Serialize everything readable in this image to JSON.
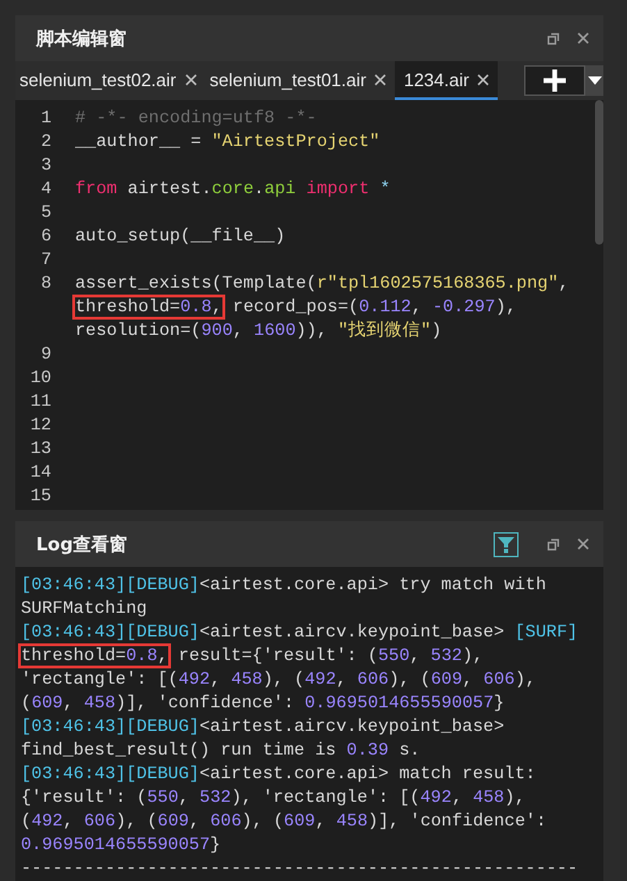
{
  "editor": {
    "title": "脚本编辑窗",
    "tabs": [
      {
        "label": "selenium_test02.air",
        "selected": false
      },
      {
        "label": "selenium_test01.air",
        "selected": false
      },
      {
        "label": "1234.air",
        "selected": true
      }
    ],
    "lines": [
      {
        "number": "1",
        "rows": [
          {
            "parts": [
              {
                "kind": "comment",
                "text": "# -*- encoding=utf8 -*-"
              }
            ]
          }
        ]
      },
      {
        "number": "2",
        "rows": [
          {
            "parts": [
              {
                "kind": "plain",
                "text": "__author__ = "
              },
              {
                "kind": "string",
                "text": "\"AirtestProject\""
              }
            ]
          }
        ]
      },
      {
        "number": "3"
      },
      {
        "number": "4",
        "rows": [
          {
            "parts": [
              {
                "kind": "keyword",
                "text": "from"
              },
              {
                "kind": "plain",
                "text": " airtest."
              },
              {
                "kind": "module",
                "text": "core"
              },
              {
                "kind": "plain",
                "text": "."
              },
              {
                "kind": "module",
                "text": "api"
              },
              {
                "kind": "keyword",
                "text": " import "
              },
              {
                "kind": "operator",
                "text": "*"
              }
            ]
          }
        ]
      },
      {
        "number": "5"
      },
      {
        "number": "6",
        "rows": [
          {
            "parts": [
              {
                "kind": "plain",
                "text": "auto_setup(__file__)"
              }
            ]
          }
        ]
      },
      {
        "number": "7"
      },
      {
        "number": "8",
        "rows": [
          {
            "parts": [
              {
                "kind": "plain",
                "text": "assert_exists(Template("
              },
              {
                "kind": "string",
                "text": "r\"tpl1602575168365.png\""
              },
              {
                "kind": "plain",
                "text": ","
              }
            ]
          },
          {
            "parts": [
              {
                "kind": "boxed",
                "parts": [
                  {
                    "kind": "plain",
                    "text": "threshold="
                  },
                  {
                    "kind": "number",
                    "text": "0.8"
                  },
                  {
                    "kind": "plain",
                    "text": ","
                  }
                ]
              },
              {
                "kind": "plain",
                "text": " record_pos=("
              },
              {
                "kind": "number",
                "text": "0.112"
              },
              {
                "kind": "plain",
                "text": ", "
              },
              {
                "kind": "number",
                "text": "-0.297"
              },
              {
                "kind": "plain",
                "text": "),"
              }
            ]
          },
          {
            "parts": [
              {
                "kind": "plain",
                "text": "resolution=("
              },
              {
                "kind": "number",
                "text": "900"
              },
              {
                "kind": "plain",
                "text": ", "
              },
              {
                "kind": "number",
                "text": "1600"
              },
              {
                "kind": "plain",
                "text": ")), "
              },
              {
                "kind": "string",
                "text": "\"找到微信\""
              },
              {
                "kind": "plain",
                "text": ")"
              }
            ]
          }
        ]
      },
      {
        "number": "9"
      },
      {
        "number": "10"
      },
      {
        "number": "11"
      },
      {
        "number": "12"
      },
      {
        "number": "13"
      },
      {
        "number": "14"
      },
      {
        "number": "15"
      }
    ]
  },
  "log": {
    "title": "Log查看窗",
    "lines": [
      {
        "parts": [
          {
            "kind": "tag",
            "text": "[03:46:43][DEBUG]"
          },
          {
            "kind": "plain",
            "text": "<airtest.core.api> try match with"
          }
        ]
      },
      {
        "parts": [
          {
            "kind": "plain",
            "text": "SURFMatching"
          }
        ]
      },
      {
        "parts": [
          {
            "kind": "tag",
            "text": "[03:46:43][DEBUG]"
          },
          {
            "kind": "plain",
            "text": "<airtest.aircv.keypoint_base> "
          },
          {
            "kind": "tag",
            "text": "[SURF]"
          }
        ]
      },
      {
        "parts": [
          {
            "kind": "boxed",
            "parts": [
              {
                "kind": "plain",
                "text": "threshold="
              },
              {
                "kind": "number",
                "text": "0.8"
              },
              {
                "kind": "plain",
                "text": ","
              }
            ]
          },
          {
            "kind": "plain",
            "text": " result={'result': ("
          },
          {
            "kind": "number",
            "text": "550"
          },
          {
            "kind": "plain",
            "text": ", "
          },
          {
            "kind": "number",
            "text": "532"
          },
          {
            "kind": "plain",
            "text": "),"
          }
        ]
      },
      {
        "parts": [
          {
            "kind": "plain",
            "text": "'rectangle': [("
          },
          {
            "kind": "number",
            "text": "492"
          },
          {
            "kind": "plain",
            "text": ", "
          },
          {
            "kind": "number",
            "text": "458"
          },
          {
            "kind": "plain",
            "text": "), ("
          },
          {
            "kind": "number",
            "text": "492"
          },
          {
            "kind": "plain",
            "text": ", "
          },
          {
            "kind": "number",
            "text": "606"
          },
          {
            "kind": "plain",
            "text": "), ("
          },
          {
            "kind": "number",
            "text": "609"
          },
          {
            "kind": "plain",
            "text": ", "
          },
          {
            "kind": "number",
            "text": "606"
          },
          {
            "kind": "plain",
            "text": "),"
          }
        ]
      },
      {
        "parts": [
          {
            "kind": "plain",
            "text": "("
          },
          {
            "kind": "number",
            "text": "609"
          },
          {
            "kind": "plain",
            "text": ", "
          },
          {
            "kind": "number",
            "text": "458"
          },
          {
            "kind": "plain",
            "text": ")], 'confidence': "
          },
          {
            "kind": "number",
            "text": "0.9695014655590057"
          },
          {
            "kind": "plain",
            "text": "}"
          }
        ]
      },
      {
        "parts": [
          {
            "kind": "tag",
            "text": "[03:46:43][DEBUG]"
          },
          {
            "kind": "plain",
            "text": "<airtest.aircv.keypoint_base>"
          }
        ]
      },
      {
        "parts": [
          {
            "kind": "plain",
            "text": "find_best_result() run time is "
          },
          {
            "kind": "number",
            "text": "0.39"
          },
          {
            "kind": "plain",
            "text": " s."
          }
        ]
      },
      {
        "parts": [
          {
            "kind": "tag",
            "text": "[03:46:43][DEBUG]"
          },
          {
            "kind": "plain",
            "text": "<airtest.core.api> match result:"
          }
        ]
      },
      {
        "parts": [
          {
            "kind": "plain",
            "text": "{'result': ("
          },
          {
            "kind": "number",
            "text": "550"
          },
          {
            "kind": "plain",
            "text": ", "
          },
          {
            "kind": "number",
            "text": "532"
          },
          {
            "kind": "plain",
            "text": "), 'rectangle': [("
          },
          {
            "kind": "number",
            "text": "492"
          },
          {
            "kind": "plain",
            "text": ", "
          },
          {
            "kind": "number",
            "text": "458"
          },
          {
            "kind": "plain",
            "text": "),"
          }
        ]
      },
      {
        "parts": [
          {
            "kind": "plain",
            "text": "("
          },
          {
            "kind": "number",
            "text": "492"
          },
          {
            "kind": "plain",
            "text": ", "
          },
          {
            "kind": "number",
            "text": "606"
          },
          {
            "kind": "plain",
            "text": "), ("
          },
          {
            "kind": "number",
            "text": "609"
          },
          {
            "kind": "plain",
            "text": ", "
          },
          {
            "kind": "number",
            "text": "606"
          },
          {
            "kind": "plain",
            "text": "), ("
          },
          {
            "kind": "number",
            "text": "609"
          },
          {
            "kind": "plain",
            "text": ", "
          },
          {
            "kind": "number",
            "text": "458"
          },
          {
            "kind": "plain",
            "text": ")], 'confidence':"
          }
        ]
      },
      {
        "parts": [
          {
            "kind": "number",
            "text": "0.9695014655590057"
          },
          {
            "kind": "plain",
            "text": "}"
          }
        ]
      },
      {
        "parts": [
          {
            "kind": "plain",
            "text": "-----------------------------------------------------"
          }
        ]
      }
    ]
  }
}
